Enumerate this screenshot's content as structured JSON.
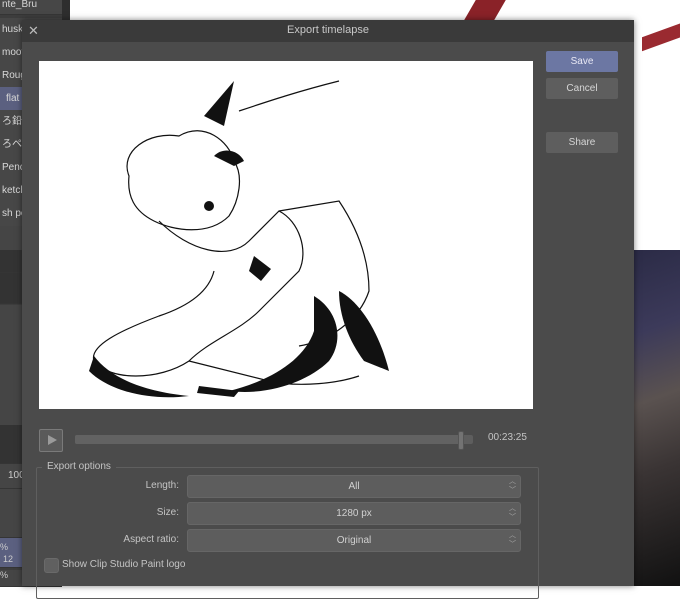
{
  "app": {
    "left_panel": {
      "brush_items": [
        "nte_Bru",
        "husk",
        "moot",
        "Roug",
        "flat",
        "ろ鉛筆",
        "ろペン",
        "Penc",
        "ketch",
        "sh pe"
      ],
      "selected_brush_index": 4,
      "value_100": "100",
      "percent_label": "%",
      "value_12": "12"
    }
  },
  "dialog": {
    "title": "Export timelapse",
    "close_icon": "close-icon",
    "buttons": {
      "save": "Save",
      "cancel": "Cancel",
      "share": "Share"
    },
    "playback": {
      "play_icon": "play-icon",
      "progress": 0.97,
      "time": "00:23:25"
    },
    "export_options": {
      "title": "Export options",
      "length": {
        "label": "Length:",
        "value": "All"
      },
      "size": {
        "label": "Size:",
        "value": "1280 px"
      },
      "aspect_ratio": {
        "label": "Aspect ratio:",
        "value": "Original"
      },
      "show_logo": {
        "label": "Show Clip Studio Paint logo",
        "checked": false
      }
    }
  },
  "colors": {
    "accent_button": "#6c77a3",
    "dialog_bg": "#4b4b4b",
    "titlebar_bg": "#3a3a3a"
  }
}
